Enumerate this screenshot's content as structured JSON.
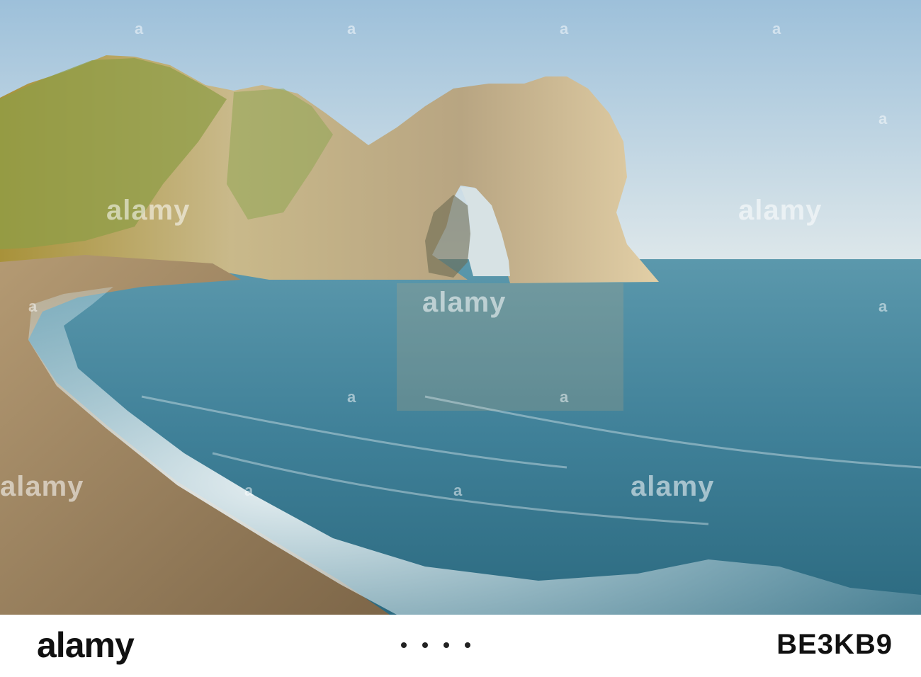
{
  "watermark": {
    "brand": "alamy",
    "colors": {
      "mark": "#ffffff"
    }
  },
  "footer": {
    "logo_text": "alamy",
    "image_id": "BE3KB9"
  },
  "scene": {
    "colors": {
      "sky_top": "#9fc2dc",
      "sky_bottom": "#dbe6ea",
      "sea_far": "#4f8fa6",
      "sea_near": "#2f6f86",
      "rock_lit": "#cdb58d",
      "grass": "#8ea04b",
      "pebbles": "#9c8464",
      "foam": "#e8f0f2"
    }
  }
}
